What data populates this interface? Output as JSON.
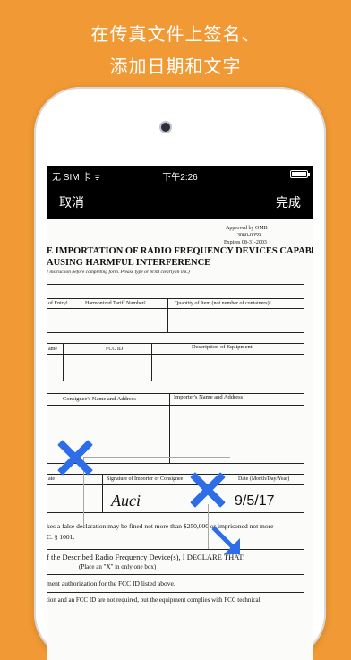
{
  "headline": {
    "line1": "在传真文件上签名、",
    "line2": "添加日期和文字"
  },
  "status_bar": {
    "carrier": "无 SIM 卡 ᯤ",
    "time": "下午2:26",
    "battery_level": 1.0
  },
  "nav_bar": {
    "cancel_label": "取消",
    "done_label": "完成"
  },
  "document": {
    "approved_line1": "Approved by OMB",
    "approved_line2": "3060-0059",
    "approved_line3": "Expires 08-31-2003",
    "title_line1": "E IMPORTATION OF RADIO FREQUENCY DEVICES CAPABLE OF",
    "title_line2": "AUSING HARMFUL INTERFERENCE",
    "instructions": "I instruction before completing form. Please type or print clearly in ink.)",
    "header_entry": "of Entry¹",
    "header_tariff": "Harmonized Tariff Number²",
    "header_quantity": "Quantity of Item (not number of containers)³",
    "header_name": "ame",
    "header_fccid": "FCC ID",
    "header_description": "Description of Equipment",
    "header_consignee": "Consignee's Name and Address",
    "header_importer": "Importer's Name and Address",
    "header_ate": "ate",
    "header_signature": "Signature of Importer or Consignee",
    "header_date": "Date (Month/Day/Year)",
    "signature_text": "Auci",
    "date_value": "9/5/17",
    "false_declaration": "kes a false declaration may be fined not more than $250,000 or imprisoned not more",
    "usc": "C. § 1001.",
    "declare": "f the Described Radio Frequency Device(s), I DECLARE THAT:",
    "place_x": "(Place an \"X\" in only one box)",
    "authorization": "ment authorization for the FCC ID listed above.",
    "equipment": "tion and an FCC ID are not required, but the equipment complies with FCC technical"
  }
}
